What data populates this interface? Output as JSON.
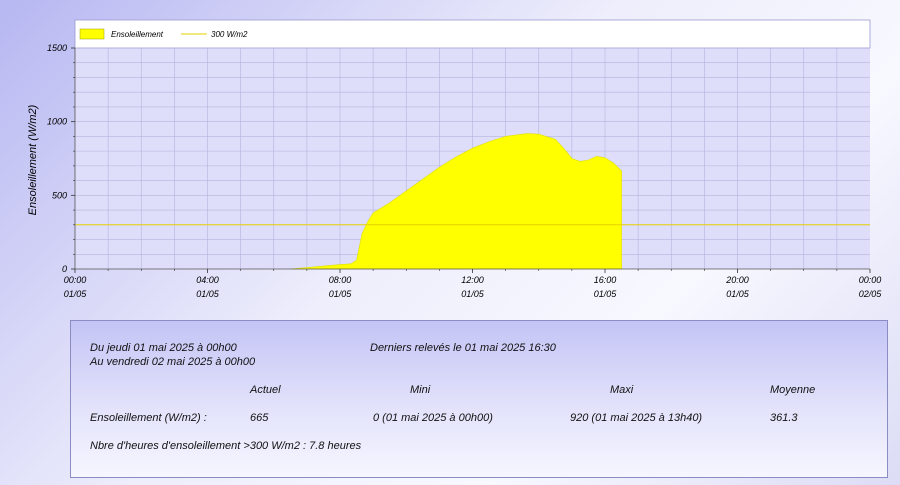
{
  "chart_data": {
    "type": "area",
    "ylabel": "Ensoleillement (W/m2)",
    "ylim": [
      0,
      1500
    ],
    "yticks": [
      "0",
      "500",
      "1000",
      "1500"
    ],
    "xlim": [
      "2025-05-01 00:00",
      "2025-05-02 00:00"
    ],
    "xticks": [
      {
        "time": "00:00",
        "date": "01/05"
      },
      {
        "time": "04:00",
        "date": "01/05"
      },
      {
        "time": "08:00",
        "date": "01/05"
      },
      {
        "time": "12:00",
        "date": "01/05"
      },
      {
        "time": "16:00",
        "date": "01/05"
      },
      {
        "time": "20:00",
        "date": "01/05"
      },
      {
        "time": "00:00",
        "date": "02/05"
      }
    ],
    "grid": true,
    "legend_position": "top-left",
    "series": [
      {
        "name": "Ensoleillement",
        "type": "area",
        "color": "#ffff00",
        "x": [
          "06:30",
          "07:00",
          "07:30",
          "08:00",
          "08:20",
          "08:30",
          "08:35",
          "08:40",
          "08:50",
          "09:00",
          "09:30",
          "10:00",
          "10:30",
          "11:00",
          "11:30",
          "12:00",
          "12:30",
          "13:00",
          "13:30",
          "13:40",
          "14:00",
          "14:30",
          "14:45",
          "15:00",
          "15:15",
          "15:30",
          "15:45",
          "16:00",
          "16:15",
          "16:30"
        ],
        "values": [
          0,
          10,
          20,
          30,
          35,
          60,
          150,
          240,
          320,
          380,
          450,
          530,
          610,
          690,
          760,
          820,
          865,
          900,
          915,
          920,
          915,
          880,
          820,
          750,
          730,
          740,
          765,
          755,
          720,
          665
        ]
      },
      {
        "name": "300 W/m2",
        "type": "line",
        "color": "#e6d200",
        "x": [
          "00:00",
          "24:00"
        ],
        "values": [
          300,
          300
        ]
      }
    ]
  },
  "stats": {
    "period_from": "Du jeudi 01 mai 2025 à 00h00",
    "period_to": "Au vendredi 02 mai 2025 à 00h00",
    "last_reading": "Derniers relevés le 01 mai 2025 16:30",
    "headers": {
      "actuel": "Actuel",
      "mini": "Mini",
      "maxi": "Maxi",
      "moyenne": "Moyenne"
    },
    "row_label": "Ensoleillement (W/m2) :",
    "actuel": "665",
    "mini": "0  (01 mai 2025 à 00h00)",
    "maxi": "920  (01 mai 2025 à 13h40)",
    "moyenne": "361.3",
    "hours_text": "Nbre d'heures d'ensoleillement >300 W/m2 :  7.8 heures"
  }
}
